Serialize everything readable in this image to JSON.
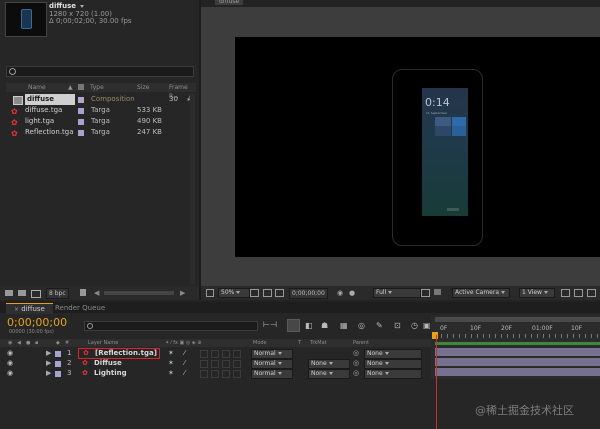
{
  "project": {
    "item_name": "diffuse",
    "item_dims": "1280 x 720 (1.00)",
    "item_duration": "Δ 0;00;02;00, 30.00 fps",
    "search_placeholder": "",
    "columns": {
      "name": "Name",
      "type": "Type",
      "size": "Size",
      "frame_rate": "Frame R..."
    },
    "items": [
      {
        "name": "diffuse",
        "type": "Composition",
        "size": "",
        "frame_rate": "30",
        "color": "#b7a6c8",
        "icon": "composition-icon"
      },
      {
        "name": "diffuse.tga",
        "type": "Targa",
        "size": "533 KB",
        "frame_rate": "",
        "color": "#a7a3cf",
        "icon": "image-file-icon"
      },
      {
        "name": "light.tga",
        "type": "Targa",
        "size": "490 KB",
        "frame_rate": "",
        "color": "#a7a3cf",
        "icon": "image-file-icon"
      },
      {
        "name": "Reflection.tga",
        "type": "Targa",
        "size": "247 KB",
        "frame_rate": "",
        "color": "#a7a3cf",
        "icon": "image-file-icon"
      }
    ],
    "bpc": "8 bpc"
  },
  "viewer": {
    "tab": "diffuse",
    "phone_time": "0:14",
    "phone_date": "11 September",
    "zoom": "50%",
    "timecode": "0;00;00;00",
    "resolution": "Full",
    "camera": "Active Camera",
    "views": "1 View"
  },
  "timeline": {
    "tabs": [
      "diffuse",
      "Render Queue"
    ],
    "current_time": "0;00;00;00",
    "frames_fps": "00000 (30.00 fps)",
    "col_layer_name": "Layer Name",
    "col_mode": "Mode",
    "col_t": "T",
    "col_trkmat": "TrkMat",
    "col_parent": "Parent",
    "ruler": [
      "0F",
      "10F",
      "20F",
      "01:00F",
      "10F"
    ],
    "layers": [
      {
        "num": "1",
        "name": "[Reflection.tga]",
        "mode": "Normal",
        "trkmat": "",
        "parent": "None"
      },
      {
        "num": "2",
        "name": "Diffuse",
        "mode": "Normal",
        "trkmat": "None",
        "parent": "None"
      },
      {
        "num": "3",
        "name": "Lighting",
        "mode": "Normal",
        "trkmat": "None",
        "parent": "None"
      }
    ]
  },
  "watermark": "@稀土掘金技术社区",
  "colors": {
    "accent_orange": "#e6a317",
    "highlight_red": "#e0202a",
    "layer_bar": "#75718f"
  }
}
